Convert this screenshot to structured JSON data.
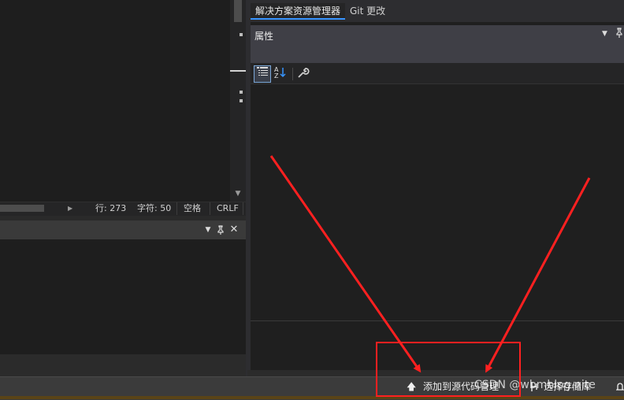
{
  "editor": {
    "status": {
      "line": "行: 273",
      "char": "字符: 50",
      "whitespace": "空格",
      "line_ending": "CRLF"
    }
  },
  "tool_panel": {
    "dropdown_icon": "chevron-down-icon",
    "pin_icon": "pin-icon",
    "close_icon": "close-icon"
  },
  "right_panel": {
    "tabs": [
      {
        "label": "解决方案资源管理器",
        "active": true
      },
      {
        "label": "Git 更改",
        "active": false
      }
    ],
    "properties": {
      "title": "属性",
      "toolbar": [
        "categorized-icon",
        "alphabetical-icon",
        "property-pages-icon"
      ]
    }
  },
  "status_bar": {
    "add_to_source_control": "添加到源代码管理",
    "select_repository": "选择存储库",
    "add_icon": "arrow-up-icon",
    "repo_icon": "repository-icon",
    "notification_icon": "bell-icon"
  },
  "watermark": "CSDN @wbmblog.nite",
  "annotations": {
    "arrow_color": "#ff2020",
    "box_color": "#ff2020"
  }
}
